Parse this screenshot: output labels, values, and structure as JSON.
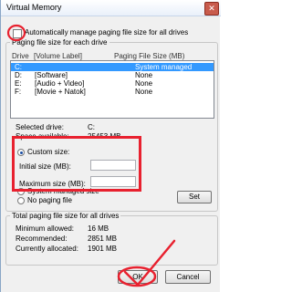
{
  "window": {
    "title": "Virtual Memory",
    "close_glyph": "✕"
  },
  "auto_manage": {
    "label": "Automatically manage paging file size for all drives",
    "checked": false
  },
  "drive_group": {
    "title": "Paging file size for each drive",
    "col_drive": "Drive",
    "col_label": "[Volume Label]",
    "col_size": "Paging File Size (MB)",
    "rows": [
      {
        "drive": "C:",
        "label": "",
        "size": "System managed",
        "selected": true
      },
      {
        "drive": "D:",
        "label": "[Software]",
        "size": "None",
        "selected": false
      },
      {
        "drive": "E:",
        "label": "[Audio + Video]",
        "size": "None",
        "selected": false
      },
      {
        "drive": "F:",
        "label": "[Movie + Natok]",
        "size": "None",
        "selected": false
      }
    ],
    "selected_drive_label": "Selected drive:",
    "selected_drive_value": "C:",
    "space_available_label": "Space available:",
    "space_available_value": "25453 MB",
    "custom_size_label": "Custom size:",
    "initial_size_label": "Initial size (MB):",
    "initial_size_value": "",
    "maximum_size_label": "Maximum size (MB):",
    "maximum_size_value": "",
    "system_managed_label": "System managed size",
    "no_paging_label": "No paging file",
    "set_button": "Set"
  },
  "total_group": {
    "title": "Total paging file size for all drives",
    "minimum_label": "Minimum allowed:",
    "minimum_value": "16 MB",
    "recommended_label": "Recommended:",
    "recommended_value": "2851 MB",
    "allocated_label": "Currently allocated:",
    "allocated_value": "1901 MB"
  },
  "buttons": {
    "ok": "OK",
    "cancel": "Cancel"
  },
  "annotation_color": "#e8212f"
}
